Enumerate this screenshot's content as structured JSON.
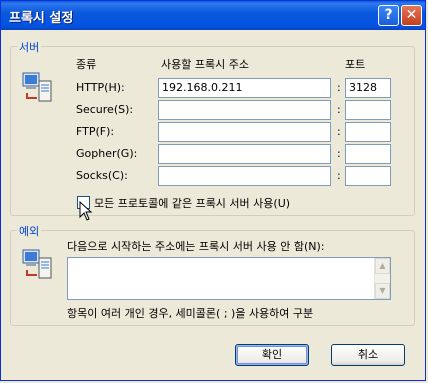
{
  "window": {
    "title": "프록시 설정"
  },
  "servers": {
    "group_label": "서버",
    "col_type": "종류",
    "col_address": "사용할 프록시 주소",
    "col_port": "포트",
    "rows": [
      {
        "label": "HTTP(H):",
        "address": "192.168.0.211",
        "port": "3128"
      },
      {
        "label": "Secure(S):",
        "address": "",
        "port": ""
      },
      {
        "label": "FTP(F):",
        "address": "",
        "port": ""
      },
      {
        "label": "Gopher(G):",
        "address": "",
        "port": ""
      },
      {
        "label": "Socks(C):",
        "address": "",
        "port": ""
      }
    ],
    "colon": ":",
    "same_proxy_label": "모든 프로토콜에 같은 프록시 서버 사용(U)",
    "same_proxy_checked": false
  },
  "exceptions": {
    "group_label": "예외",
    "instruction": "다음으로 시작하는 주소에는 프록시 서버 사용 안 함(N):",
    "value": "",
    "hint": "항목이 여러 개인 경우, 세미콜론( ; )을 사용하여 구분"
  },
  "buttons": {
    "ok": "확인",
    "cancel": "취소"
  },
  "colors": {
    "title_blue": "#0454e3",
    "group_label": "#0046d5",
    "face": "#ece9d8"
  }
}
